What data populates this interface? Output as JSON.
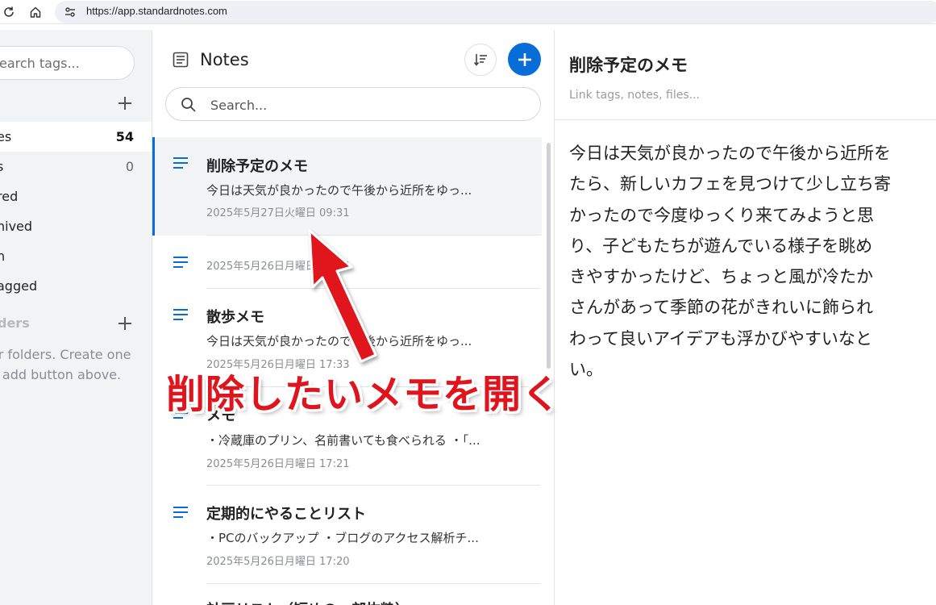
{
  "browser": {
    "url": "https://app.standardnotes.com"
  },
  "tags_panel": {
    "search_placeholder": "earch tags...",
    "items": [
      {
        "label": "es",
        "count": "54"
      },
      {
        "label": "s",
        "count": "0"
      },
      {
        "label": "red",
        "count": ""
      },
      {
        "label": "hived",
        "count": ""
      },
      {
        "label": "h",
        "count": ""
      },
      {
        "label": "agged",
        "count": ""
      }
    ],
    "folders_heading": "ders",
    "folders_help_line1": "or folders. Create one",
    "folders_help_line2": "e add button above."
  },
  "notes_panel": {
    "title": "Notes",
    "search_placeholder": "Search...",
    "notes": [
      {
        "title": "削除予定のメモ",
        "preview": "今日は天気が良かったので午後から近所をゆっ...",
        "date": "2025年5月27日火曜日 09:31",
        "selected": true
      },
      {
        "title": "",
        "preview": "",
        "date": "2025年5月26日月曜日 17:36",
        "selected": false
      },
      {
        "title": "散歩メモ",
        "preview": "今日は天気が良かったので午後から近所をゆっ...",
        "date": "2025年5月26日月曜日 17:33",
        "selected": false
      },
      {
        "title": "メモ",
        "preview": "・冷蔵庫のプリン、名前書いても食べられる ・「...",
        "date": "2025年5月26日月曜日 17:21",
        "selected": false
      },
      {
        "title": "定期的にやることリスト",
        "preview": "・PCのバックアップ ・ブログのアクセス解析チ...",
        "date": "2025年5月26日月曜日 17:20",
        "selected": false
      },
      {
        "title": "計画リスト（短めの一部抜粋）",
        "preview": "",
        "date": "",
        "selected": false
      }
    ]
  },
  "editor": {
    "title": "削除予定のメモ",
    "link_placeholder": "Link tags, notes, files...",
    "body": "今日は天気が良かったので午後から近所を\nたら、新しいカフェを見つけて少し立ち寄\nかったので今度ゆっくり来てみようと思\nり、子どもたちが遊んでいる様子を眺め\nきやすかったけど、ちょっと風が冷たか\nさんがあって季節の花がきれいに飾られ\nわって良いアイデアも浮かびやすいなと\nい。"
  },
  "annotation": {
    "text": "削除したいメモを開く",
    "color": "#e0141c"
  },
  "colors": {
    "accent": "#086dd6"
  }
}
